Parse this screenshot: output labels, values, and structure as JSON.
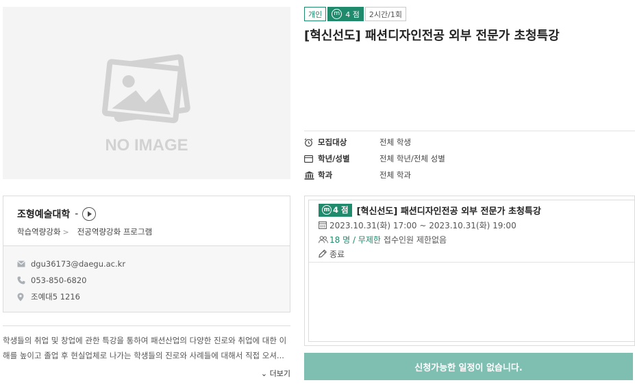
{
  "image": {
    "placeholder_text": "NO IMAGE",
    "icon": "image-placeholder-icon"
  },
  "badges": [
    {
      "label": "개인"
    },
    {
      "label": "4 점",
      "icon": "mileage-m-icon"
    },
    {
      "label": "2시간/1회"
    }
  ],
  "program": {
    "title": "[혁신선도] 패션디자인전공 외부 전문가 초청특강"
  },
  "meta": [
    {
      "icon": "alarm-clock-icon",
      "label": "모집대상",
      "value": "전체 학생"
    },
    {
      "icon": "id-card-icon",
      "label": "학년/성별",
      "value": "전체 학년/전체 성별"
    },
    {
      "icon": "institution-icon",
      "label": "학과",
      "value": "전체 학과"
    }
  ],
  "department": {
    "name": "조형예술대학",
    "dash": "-",
    "path": [
      "학습역량강화",
      "전공역량강화 프로그램"
    ],
    "path_separator": ">",
    "email": "dgu36173@daegu.ac.kr",
    "phone": "053-850-6820",
    "location": "조예대5 1216"
  },
  "description": {
    "line1": "학생들의 취업 및 창업에 관한 특강을 통하여 패션산업의 다양한 진로와 취업에 대한 이",
    "line2": "해를 높이고 졸업 후 현실업체로 나가는 학생들의 진로와 사례들에 대해서 직접 오셔...",
    "more_label": "더보기"
  },
  "schedule": {
    "points": "4 점",
    "title": "[혁신선도] 패션디자인전공 외부 전문가 초청특강",
    "datetime": "2023.10.31(화) 17:00 ~ 2023.10.31(화) 19:00",
    "capacity_count": "18 명 / 무제한",
    "capacity_note": "접수인원 제한없음",
    "status": "종료"
  },
  "apply_button": {
    "label": "신청가능한 일정이 없습니다."
  },
  "colors": {
    "accent": "#1f8a6c",
    "button_disabled": "#7fbfb2"
  }
}
